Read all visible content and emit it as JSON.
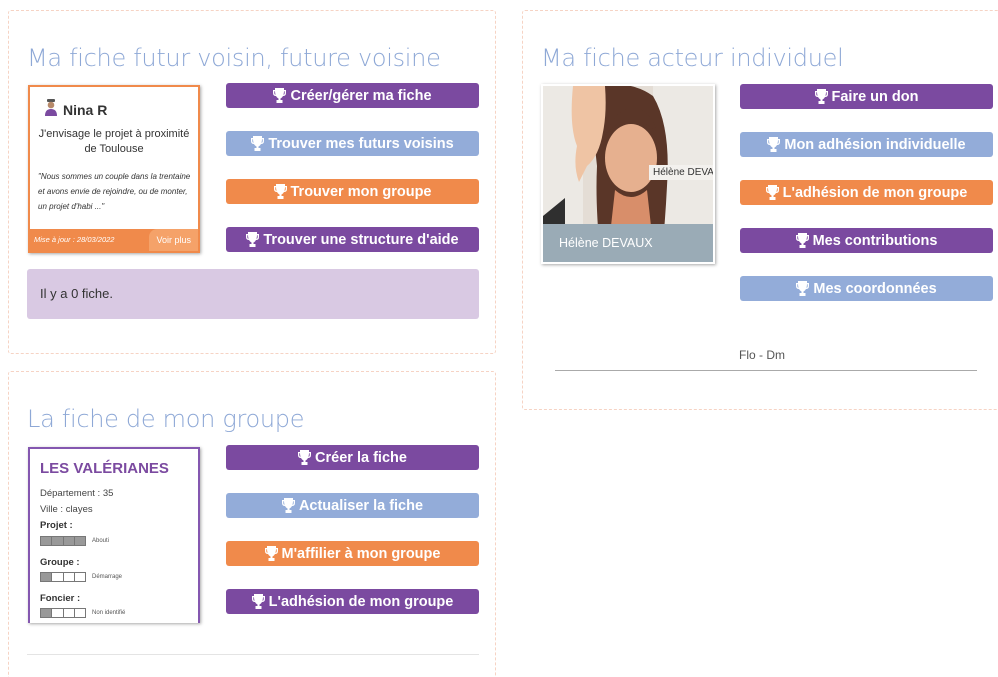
{
  "panels": {
    "voisin": {
      "title": "Ma fiche futur voisin, future voisine",
      "card": {
        "name": "Nina R",
        "summary": "J'envisage le projet à proximité de Toulouse",
        "quote": "\"Nous sommes un couple dans la trentaine et avons envie de rejoindre, ou de monter, un projet d'habi ...\"",
        "update": "Mise à jour : 28/03/2022",
        "more_label": "Voir plus"
      },
      "buttons": [
        {
          "label": "Créer/gérer ma fiche",
          "color": "#7b4aa0"
        },
        {
          "label": "Trouver mes futurs voisins",
          "color": "#93acd9"
        },
        {
          "label": "Trouver mon groupe",
          "color": "#f08a4b"
        },
        {
          "label": "Trouver une structure d'aide",
          "color": "#7b4aa0"
        }
      ],
      "count_text": "Il y a 0 fiche."
    },
    "groupe": {
      "title": "La fiche de mon groupe",
      "card": {
        "name": "LES VALÉRIANES",
        "departement": "Département : 35",
        "ville": "Ville : clayes",
        "projet_label": "Projet :",
        "projet_status": "Abouti",
        "projet_level": 4,
        "groupe_label": "Groupe :",
        "groupe_status": "Démarrage",
        "groupe_level": 1,
        "foncier_label": "Foncier :",
        "foncier_status": "Non identifié",
        "foncier_level": 1
      },
      "buttons": [
        {
          "label": "Créer la fiche",
          "color": "#7b4aa0"
        },
        {
          "label": "Actualiser la fiche",
          "color": "#93acd9"
        },
        {
          "label": "M'affilier à mon groupe",
          "color": "#f08a4b"
        },
        {
          "label": "L'adhésion de mon groupe",
          "color": "#7b4aa0"
        }
      ]
    },
    "acteur": {
      "title": "Ma fiche acteur individuel",
      "photo_tag": "Hélène DEVAUX",
      "photo_caption": "Hélène DEVAUX",
      "buttons": [
        {
          "label": "Faire un don",
          "color": "#7b4aa0"
        },
        {
          "label": "Mon adhésion individuelle",
          "color": "#93acd9"
        },
        {
          "label": "L'adhésion de mon groupe",
          "color": "#f08a4b"
        },
        {
          "label": "Mes contributions",
          "color": "#7b4aa0"
        },
        {
          "label": "Mes coordonnées",
          "color": "#93acd9"
        }
      ],
      "signature": "Flo - Dm"
    }
  },
  "icons": {
    "button_icon": "trophy-icon",
    "card_user_icon": "user-icon"
  }
}
